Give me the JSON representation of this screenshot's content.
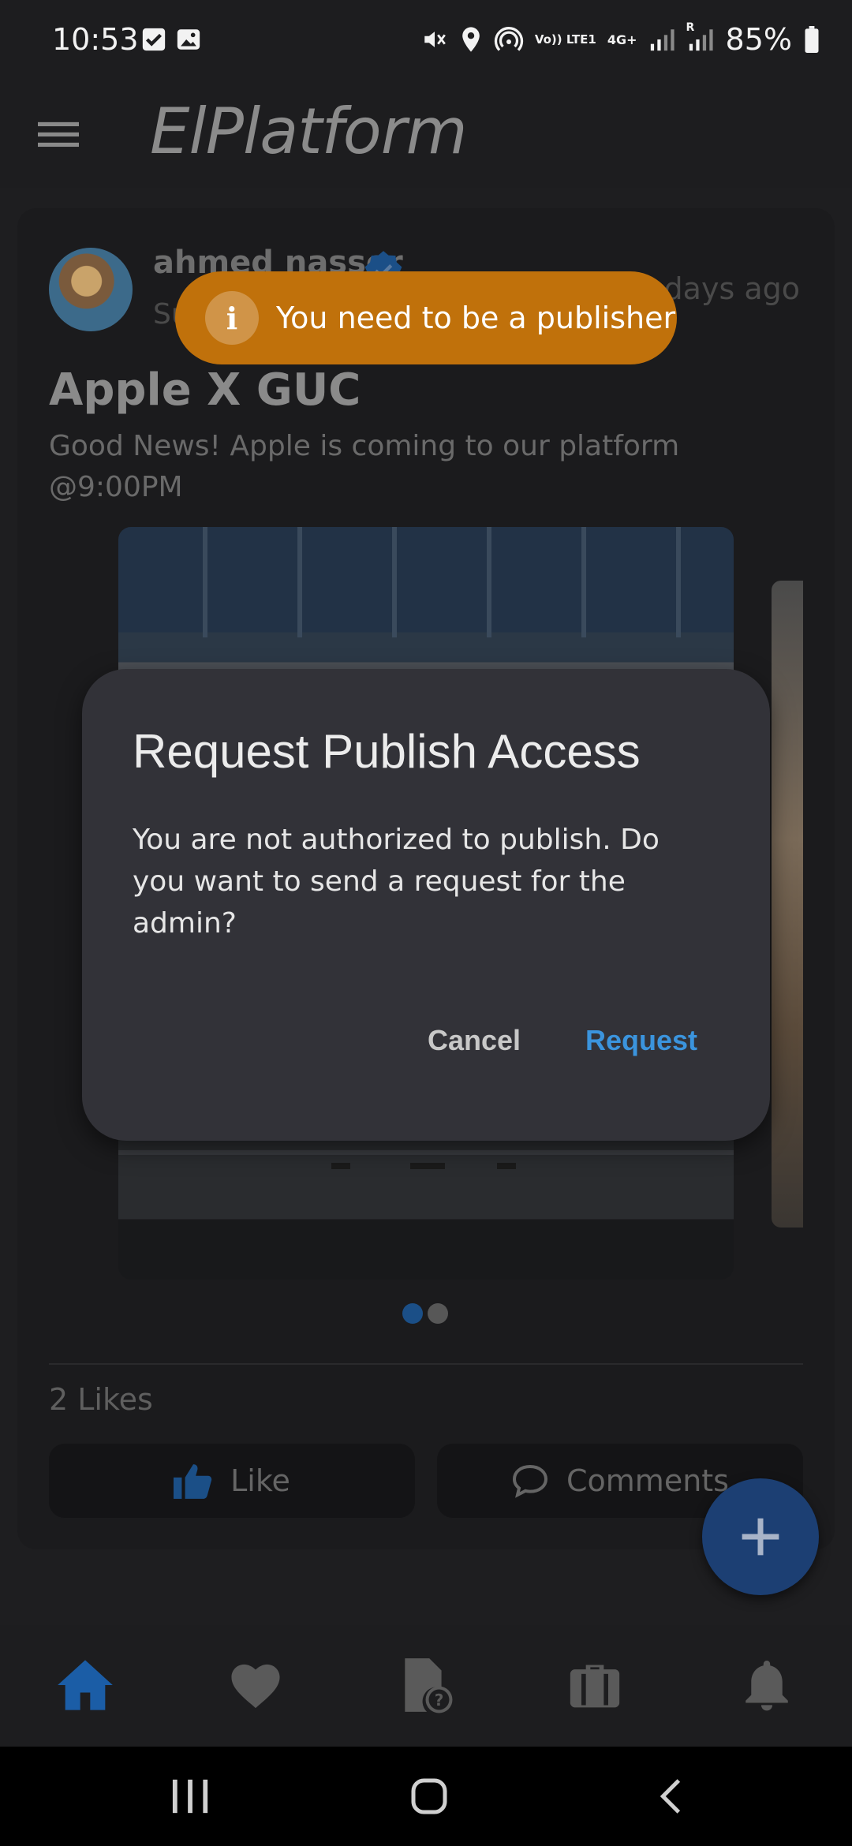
{
  "status_bar": {
    "time": "10:53",
    "battery": "85%",
    "icons": [
      "checkbox-notification-icon",
      "image-notification-icon",
      "mute-icon",
      "location-icon",
      "hotspot-icon",
      "volte-icon",
      "4g-icon",
      "signal-icon",
      "signal-roaming-icon",
      "battery-icon"
    ],
    "volte_label": "Vo)) LTE1",
    "network_label": "4G+",
    "roaming_label": "R"
  },
  "app_bar": {
    "title": "ElPlatform"
  },
  "post": {
    "author": "ahmed nasser",
    "role": "Super Admin",
    "time_ago": "11 days ago",
    "title": "Apple X GUC",
    "body": "Good News! Apple is coming to our platform @9:00PM",
    "likes": "2 Likes",
    "like_label": "Like",
    "comments_label": "Comments",
    "image_count": 2,
    "active_image": 1
  },
  "toast": {
    "message": "You need to be a publisher",
    "icon_glyph": "i"
  },
  "dialog": {
    "title": "Request Publish Access",
    "body": "You are not authorized to publish. Do you want to send a request for the admin?",
    "cancel": "Cancel",
    "confirm": "Request"
  },
  "bottom_nav": [
    "home-icon",
    "favorites-icon",
    "file-question-icon",
    "briefcase-icon",
    "notifications-icon"
  ],
  "colors": {
    "accent": "#3b94dd",
    "toast": "#c0710b",
    "nav_active": "#1b5da6",
    "fab": "#1c3f73"
  }
}
